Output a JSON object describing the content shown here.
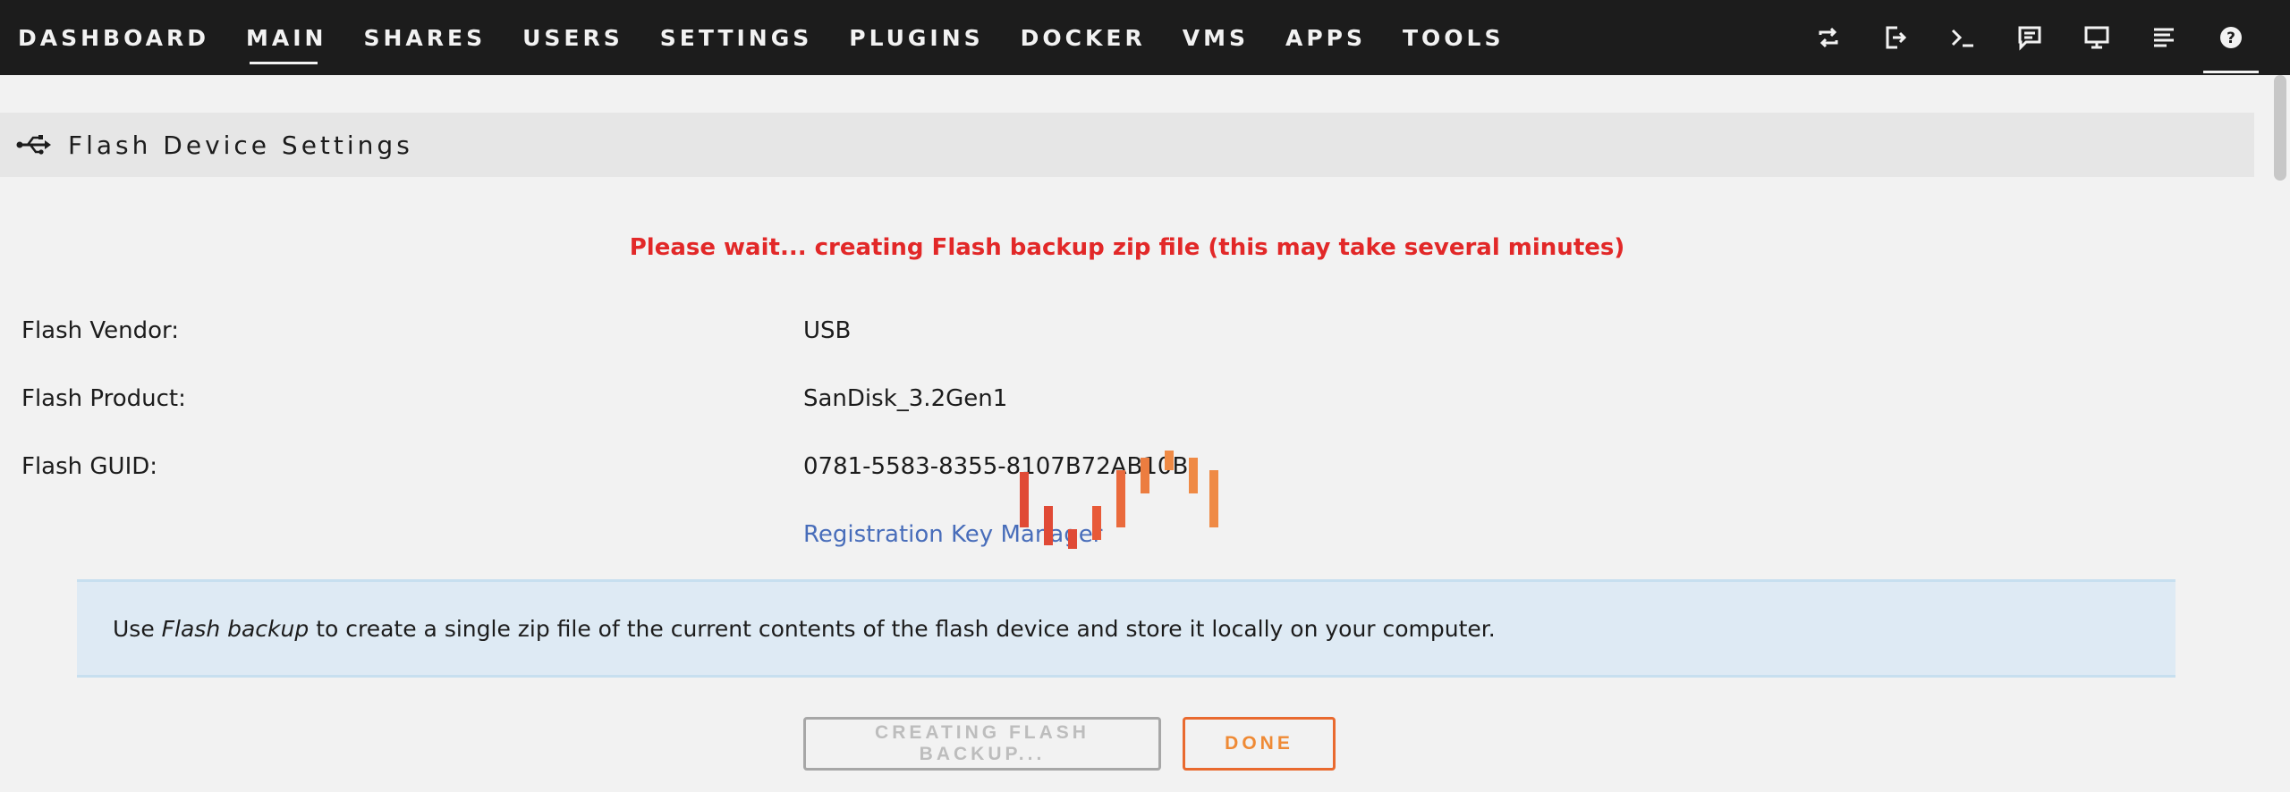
{
  "nav": {
    "items": [
      {
        "label": "DASHBOARD",
        "active": false
      },
      {
        "label": "MAIN",
        "active": true
      },
      {
        "label": "SHARES",
        "active": false
      },
      {
        "label": "USERS",
        "active": false
      },
      {
        "label": "SETTINGS",
        "active": false
      },
      {
        "label": "PLUGINS",
        "active": false
      },
      {
        "label": "DOCKER",
        "active": false
      },
      {
        "label": "VMS",
        "active": false
      },
      {
        "label": "APPS",
        "active": false
      },
      {
        "label": "TOOLS",
        "active": false
      }
    ],
    "icons": [
      "switch-language-icon",
      "logout-icon",
      "terminal-icon",
      "feedback-icon",
      "info-icon",
      "log-icon",
      "help-icon"
    ]
  },
  "panel": {
    "title": "Flash Device Settings",
    "icon": "usb-icon"
  },
  "status": {
    "message": "Please wait... creating Flash backup zip file (this may take several minutes)",
    "color": "#e22828"
  },
  "flash": {
    "vendor_label": "Flash Vendor:",
    "vendor_value": "USB",
    "product_label": "Flash Product:",
    "product_value": "SanDisk_3.2Gen1",
    "guid_label": "Flash GUID:",
    "guid_value": "0781-5583-8355-8107B72AB10B",
    "registration_link": "Registration Key Manager"
  },
  "notice": {
    "prefix": "Use ",
    "emphasis": "Flash backup",
    "suffix": " to create a single zip file of the current contents of the flash device and store it locally on your computer."
  },
  "buttons": {
    "backup_label": "CREATING FLASH BACKUP...",
    "done_label": "DONE"
  },
  "colors": {
    "accent": "#e96a2f",
    "link": "#486dba",
    "nav_bg": "#1c1c1c",
    "notice_bg": "#deeaf4"
  }
}
